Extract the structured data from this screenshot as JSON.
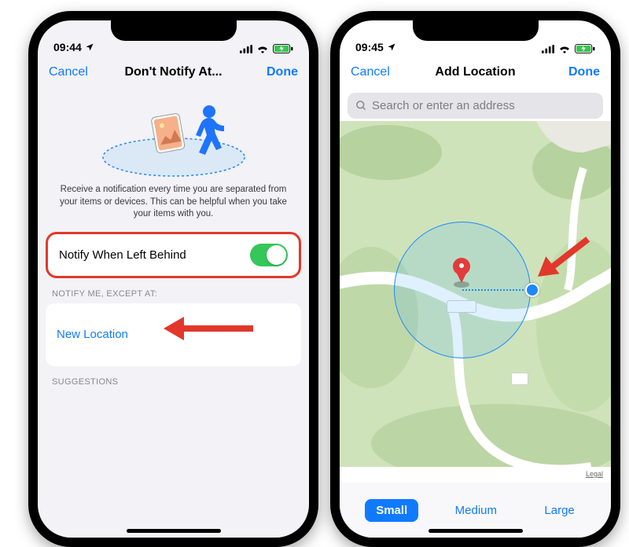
{
  "status": {
    "time_left": "09:44",
    "time_right": "09:45",
    "location_icon": "location-arrow",
    "battery_icon": "battery-charging",
    "signal_icon": "signal-bars",
    "wifi_icon": "wifi"
  },
  "left": {
    "nav": {
      "cancel": "Cancel",
      "title": "Don't Notify At...",
      "done": "Done"
    },
    "description": "Receive a notification every time you are separated from your items or devices. This can be helpful when you take your items with you.",
    "toggle_label": "Notify When Left Behind",
    "toggle_on": true,
    "section_except": "NOTIFY ME, EXCEPT AT:",
    "new_location": "New Location",
    "section_suggestions": "SUGGESTIONS",
    "hero": {
      "ipad_icon": "ipad-device",
      "person_icon": "walking-person"
    }
  },
  "right": {
    "nav": {
      "cancel": "Cancel",
      "title": "Add Location",
      "done": "Done"
    },
    "search_placeholder": "Search or enter an address",
    "legal": "Legal",
    "segments": {
      "small": "Small",
      "medium": "Medium",
      "large": "Large",
      "selected": "small"
    },
    "pin_icon": "map-pin",
    "handle_icon": "radius-handle"
  },
  "colors": {
    "accent": "#0a84ff",
    "switch_on": "#34c759",
    "annotation": "#e1382b"
  }
}
